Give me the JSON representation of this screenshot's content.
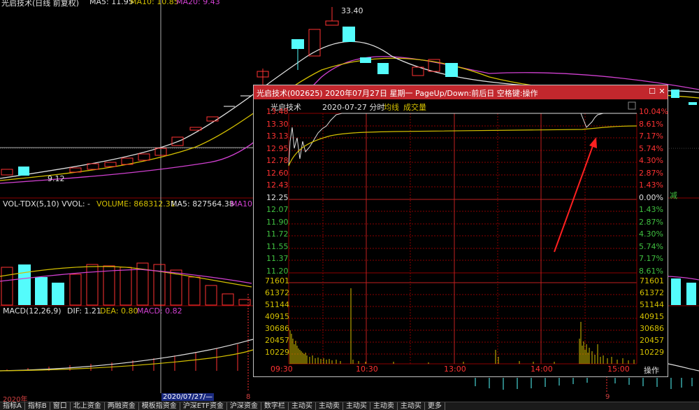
{
  "daily": {
    "header": "光启技术(日线 前复权)",
    "ma5": "MA5: 11.95",
    "ma10": "MA10: 10.85",
    "ma20": "MA20: 9.43",
    "high_label": "33.40",
    "low_label": "9.12",
    "vol_header": "VOL-TDX(5,10) VVOL: -",
    "volume": "VOLUME: 868312.31",
    "vol_ma5": "MA5: 827564.38",
    "vol_ma10": "MA10",
    "macd_header": "MACD(12,26,9)",
    "dif": "DIF: 1.21",
    "dea": "DEA: 0.80",
    "macd": "MACD: 0.82",
    "side_label": "减"
  },
  "datebar": {
    "year": "2020年",
    "cursor_date": "2020/07/27/—",
    "month_a": "8",
    "month_b": "9"
  },
  "tabs": [
    "指标A",
    "指标B",
    "窗口",
    "北上资金",
    "两融资金",
    "模板指资金",
    "沪深ETF资金",
    "沪深资金",
    "数字栏",
    "主动买",
    "主动卖",
    "主动买",
    "主动卖",
    "主动买",
    "更多"
  ],
  "popup": {
    "title": "光启技术(002625) 2020年07月27日 星期一 PageUp/Down:前后日 空格键:操作",
    "stock": "光启技术",
    "date": "2020-07-27 分时",
    "avg_label": "均线",
    "vol_label": "成交量",
    "price_ticks": [
      "13.48",
      "13.30",
      "13.13",
      "12.95",
      "12.78",
      "12.60",
      "12.43",
      "12.25",
      "12.07",
      "11.90",
      "11.72",
      "11.55",
      "11.37",
      "11.20"
    ],
    "pct_ticks": [
      "10.04%",
      "8.61%",
      "7.17%",
      "5.74%",
      "4.30%",
      "2.87%",
      "1.43%",
      "0.00%",
      "1.43%",
      "2.87%",
      "4.30%",
      "5.74%",
      "7.17%",
      "8.61%"
    ],
    "vol_ticks": [
      "71601",
      "61372",
      "51144",
      "40915",
      "30686",
      "20457",
      "10229"
    ],
    "time_ticks": [
      "09:30",
      "10:30",
      "13:00",
      "14:00",
      "15:00"
    ],
    "action_btn": "操作"
  },
  "colors": {
    "up": "#ff3232",
    "down": "#54fcfc",
    "ma_white": "#e0e0e0",
    "ma_yellow": "#d4c000",
    "ma_magenta": "#d040d0",
    "title_red": "#c2272d"
  }
}
